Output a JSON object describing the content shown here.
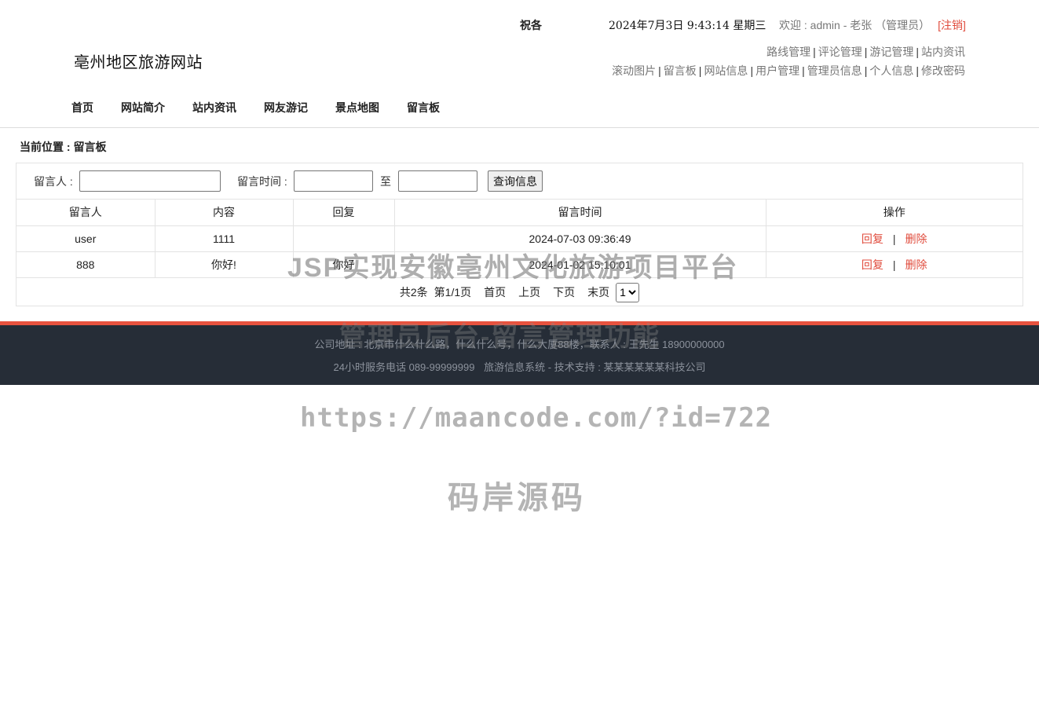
{
  "header": {
    "site_name": "亳州地区旅游网站",
    "top_left_text": "祝各",
    "clock": "2024年7月3日 9:43:14 星期三",
    "welcome": "欢迎 : admin - 老张 （管理员）",
    "logout": "[注销]",
    "admin_links_row1": [
      "路线管理",
      "评论管理",
      "游记管理",
      "站内资讯"
    ],
    "admin_links_row2": [
      "滚动图片",
      "留言板",
      "网站信息",
      "用户管理",
      "管理员信息",
      "个人信息",
      "修改密码"
    ],
    "separator": "|"
  },
  "nav": [
    "首页",
    "网站简介",
    "站内资讯",
    "网友游记",
    "景点地图",
    "留言板"
  ],
  "breadcrumb": "当前位置 : 留言板",
  "search": {
    "author_label": "留言人 :",
    "author_value": "",
    "time_label": "留言时间 :",
    "time_from_value": "",
    "to_label": "至",
    "time_to_value": "",
    "button": "查询信息"
  },
  "table": {
    "headers": [
      "留言人",
      "内容",
      "回复",
      "留言时间",
      "操作"
    ],
    "rows": [
      {
        "author": "user",
        "content": "1111",
        "reply": "",
        "time": "2024-07-03 09:36:49"
      },
      {
        "author": "888",
        "content": "你好!",
        "reply": "你好",
        "time": "2024-01-02 15:10:01"
      }
    ],
    "actions": {
      "reply": "回复",
      "delete": "删除",
      "sep": "|"
    }
  },
  "pager": {
    "total": "共2条",
    "page": "第1/1页",
    "first": "首页",
    "prev": "上页",
    "next": "下页",
    "last": "末页",
    "select_value": "1"
  },
  "footer": {
    "line1": "公司地址 : 北京市什么什么路，什么什么号，什么大厦88楼，联系人 : 王先生 18900000000",
    "hotline": "24小时服务电话   089-99999999",
    "system": "旅游信息系统 - 技术支持 : 某某某某某某科技公司"
  },
  "watermarks": {
    "title": "JSP实现安徽亳州文化旅游项目平台",
    "subtitle": "管理员后台-留言管理功能",
    "url": "https://maancode.com/?id=722",
    "brand": "码岸源码"
  },
  "colors": {
    "accent": "#e04b3c",
    "footer_bg": "#262d37",
    "footer_bar": "#e8533f"
  }
}
